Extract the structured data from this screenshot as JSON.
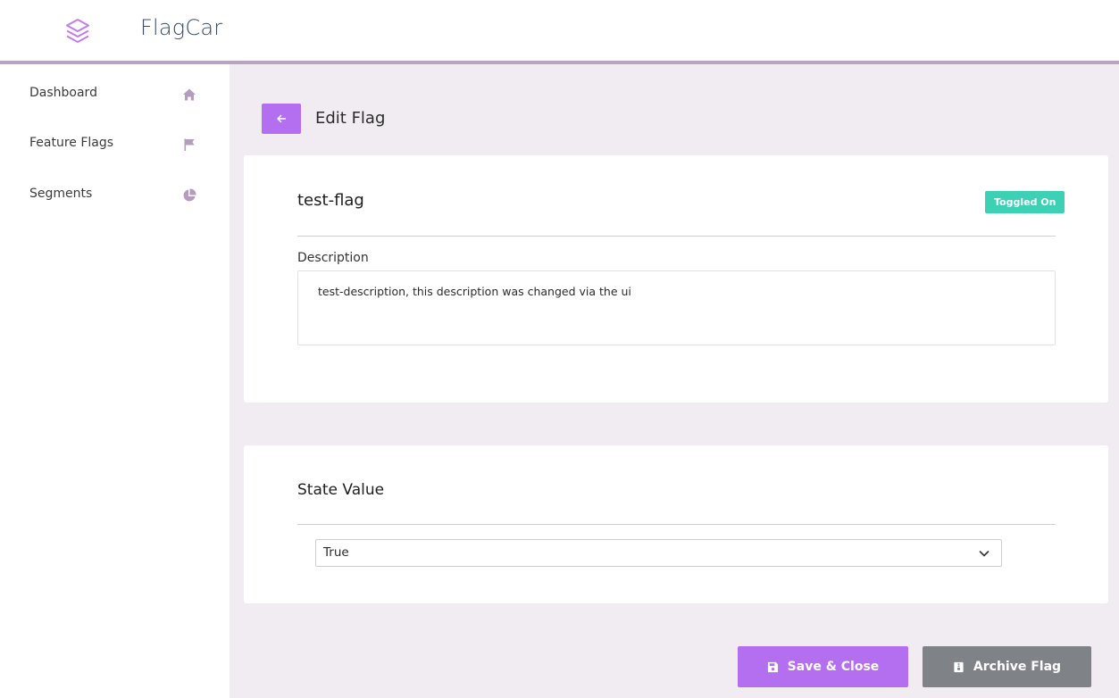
{
  "app": {
    "title": "FlagCar"
  },
  "sidebar": {
    "items": [
      {
        "label": "Dashboard",
        "icon": "home-icon"
      },
      {
        "label": "Feature Flags",
        "icon": "flag-icon"
      },
      {
        "label": "Segments",
        "icon": "pie-chart-icon"
      }
    ]
  },
  "page": {
    "title": "Edit Flag",
    "back_icon": "arrow-left-icon"
  },
  "flag": {
    "name": "test-flag",
    "status_badge": "Toggled On",
    "description_label": "Description",
    "description": "test-description, this description was changed via the ui"
  },
  "state": {
    "title": "State Value",
    "selected": "True"
  },
  "actions": {
    "save_label": "Save & Close",
    "archive_label": "Archive Flag"
  },
  "colors": {
    "accent": "#b46ef0",
    "badge": "#3cd0b4",
    "archive": "#7f8388",
    "background": "#f1ebf2"
  }
}
